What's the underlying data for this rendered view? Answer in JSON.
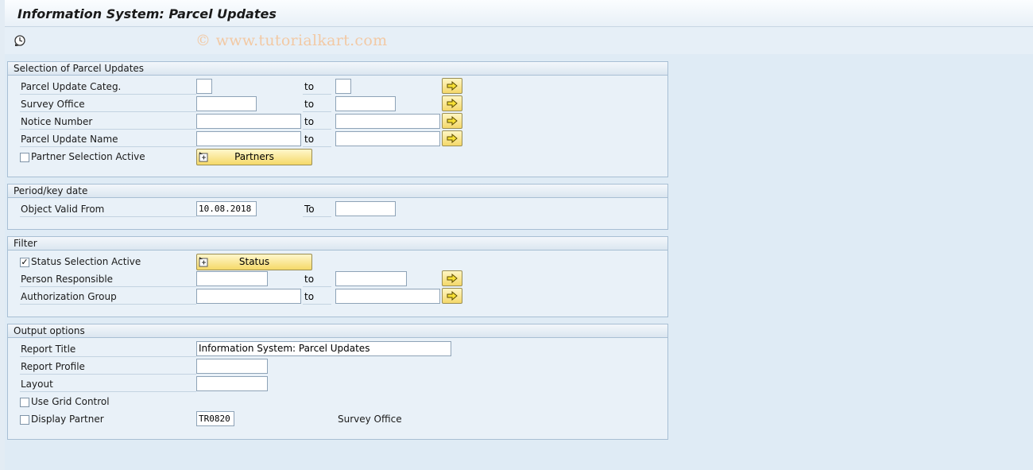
{
  "window": {
    "title": "Information System: Parcel Updates"
  },
  "toolbar": {
    "execute_icon": "execute-icon"
  },
  "watermark": "© www.tutorialkart.com",
  "selection": {
    "header": "Selection of Parcel Updates",
    "to_label": "to",
    "rows": [
      {
        "label": "Parcel Update Categ.",
        "from": "",
        "to": ""
      },
      {
        "label": "Survey Office",
        "from": "",
        "to": ""
      },
      {
        "label": "Notice Number",
        "from": "",
        "to": ""
      },
      {
        "label": "Parcel Update Name",
        "from": "",
        "to": ""
      }
    ],
    "partner_checkbox_label": "Partner Selection Active",
    "partner_checked": false,
    "partners_button": "Partners"
  },
  "period": {
    "header": "Period/key date",
    "valid_from_label": "Object Valid From",
    "valid_from_value": "10.08.2018",
    "to_label": "To",
    "to_value": ""
  },
  "filter": {
    "header": "Filter",
    "status_checkbox_label": "Status Selection Active",
    "status_checked": true,
    "status_button": "Status",
    "to_label": "to",
    "rows": [
      {
        "label": "Person Responsible",
        "from": "",
        "to": ""
      },
      {
        "label": "Authorization Group",
        "from": "",
        "to": ""
      }
    ]
  },
  "output": {
    "header": "Output options",
    "report_title_label": "Report Title",
    "report_title_value": "Information System: Parcel Updates",
    "report_profile_label": "Report Profile",
    "report_profile_value": "",
    "layout_label": "Layout",
    "layout_value": "",
    "grid_label": "Use Grid Control",
    "grid_checked": false,
    "display_partner_label": "Display Partner",
    "display_partner_checked": false,
    "display_partner_value": "TR0820",
    "display_partner_desc": "Survey Office"
  },
  "colors": {
    "background": "#dfebf5",
    "button_yellow": "#f5d968",
    "border": "#a8bfd4"
  }
}
